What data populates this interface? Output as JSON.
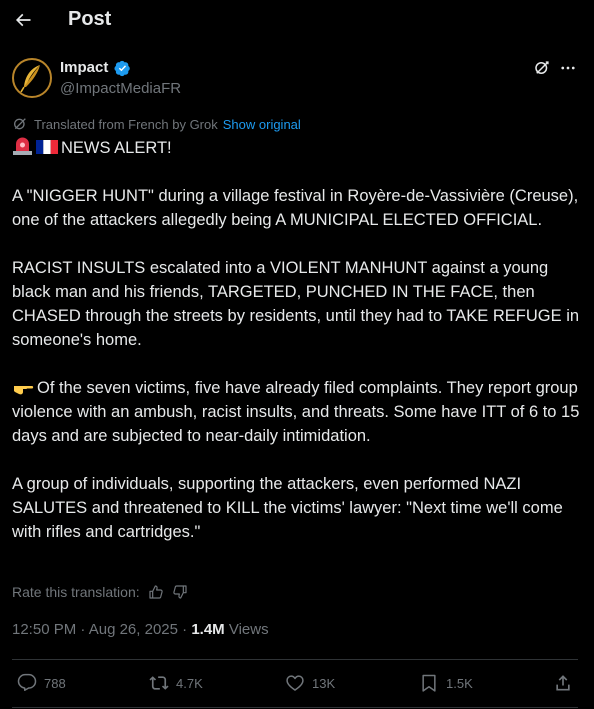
{
  "header": {
    "title": "Post"
  },
  "author": {
    "name": "Impact",
    "handle": "@ImpactMediaFR"
  },
  "translation": {
    "note": "Translated from French by Grok",
    "show_original": "Show original",
    "rate_label": "Rate this translation:"
  },
  "post": {
    "alert_line": "NEWS ALERT!",
    "para1": "A \"NIGGER HUNT\" during a village festival in Royère-de-Vassivière (Creuse), one of the attackers allegedly being A MUNICIPAL ELECTED OFFICIAL.",
    "para2": "RACIST INSULTS escalated into a VIOLENT MANHUNT against a young black man and his friends, TARGETED, PUNCHED IN THE FACE, then CHASED through the streets by residents, until they had to TAKE REFUGE in someone's home.",
    "para3": "Of the seven victims, five have already filed complaints. They report group violence with an ambush, racist insults, and threats. Some have ITT of 6 to 15 days and are subjected to near-daily intimidation.",
    "para4": "A group of individuals, supporting the attackers, even performed NAZI SALUTES and threatened to KILL the victims' lawyer: \"Next time we'll come with rifles and cartridges.\""
  },
  "meta": {
    "time": "12:50 PM",
    "date": "Aug 26, 2025",
    "views_count": "1.4M",
    "views_label": "Views"
  },
  "actions": {
    "replies": "788",
    "reposts": "4.7K",
    "likes": "13K",
    "bookmarks": "1.5K"
  },
  "colors": {
    "background": "#000000",
    "text": "#e7e9ea",
    "muted": "#71767b",
    "accent": "#1d9bf0",
    "divider": "#2f3336"
  },
  "icons": [
    "back-arrow-icon",
    "verified-badge-icon",
    "grok-icon",
    "more-icon",
    "reply-icon",
    "repost-icon",
    "like-icon",
    "bookmark-icon",
    "share-icon",
    "thumbs-up-icon",
    "thumbs-down-icon",
    "police-light-emoji",
    "france-flag-emoji",
    "pointing-hand-emoji"
  ]
}
